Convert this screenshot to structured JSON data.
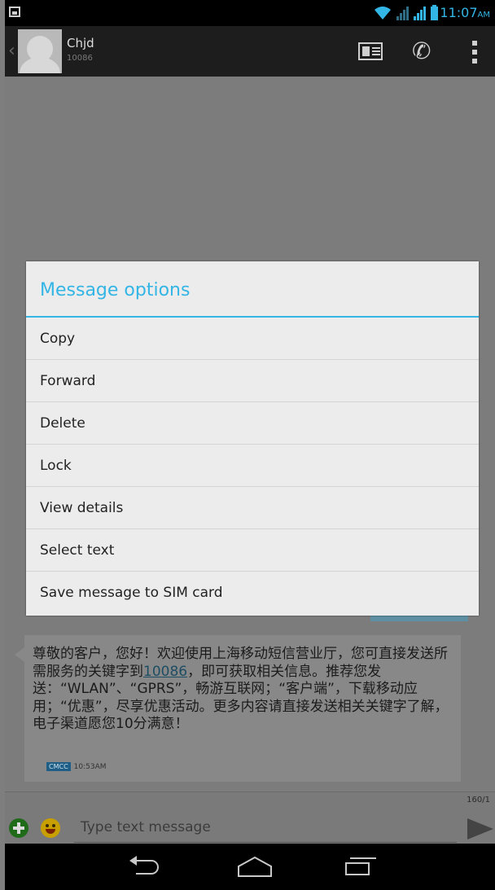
{
  "status_bar": {
    "time": "11:07",
    "ampm": "AM"
  },
  "action_bar": {
    "contact_name": "Chjd",
    "contact_number": "10086"
  },
  "dialog": {
    "title": "Message options",
    "options": [
      {
        "label": "Copy"
      },
      {
        "label": "Forward"
      },
      {
        "label": "Delete"
      },
      {
        "label": "Lock"
      },
      {
        "label": "View details"
      },
      {
        "label": "Select text"
      },
      {
        "label": "Save message to SIM card"
      }
    ]
  },
  "received_message": {
    "text_before_link": "尊敬的客户，您好！欢迎使用上海移动短信营业厅，您可直接发送所需服务的关键字到",
    "link": "10086",
    "text_after_link": "，即可获取相关信息。推荐您发送：“WLAN”、“GPRS”，畅游互联网；“客户端”，下载移动应用；“优惠”，尽享优惠活动。更多内容请直接发送相关关键字了解，电子渠道愿您10分满意！",
    "sim_label": "CMCC",
    "time": "10:53AM"
  },
  "compose": {
    "char_count": "160/1",
    "placeholder": "Type text message"
  },
  "icons": {
    "notification": "image-notification-icon",
    "wifi": "wifi-icon",
    "signal": "signal-icon",
    "battery": "battery-icon",
    "back": "back-chevron-icon",
    "contact_card": "contact-card-icon",
    "call": "phone-icon",
    "overflow": "overflow-menu-icon",
    "attach": "add-attachment-icon",
    "emoji": "emoji-icon",
    "send": "send-icon",
    "nav_back": "nav-back-icon",
    "nav_home": "nav-home-icon",
    "nav_recents": "nav-recents-icon"
  },
  "colors": {
    "accent": "#33b5e5",
    "dialog_bg": "#ececec",
    "sent_bubble": "#5f8fa3"
  }
}
